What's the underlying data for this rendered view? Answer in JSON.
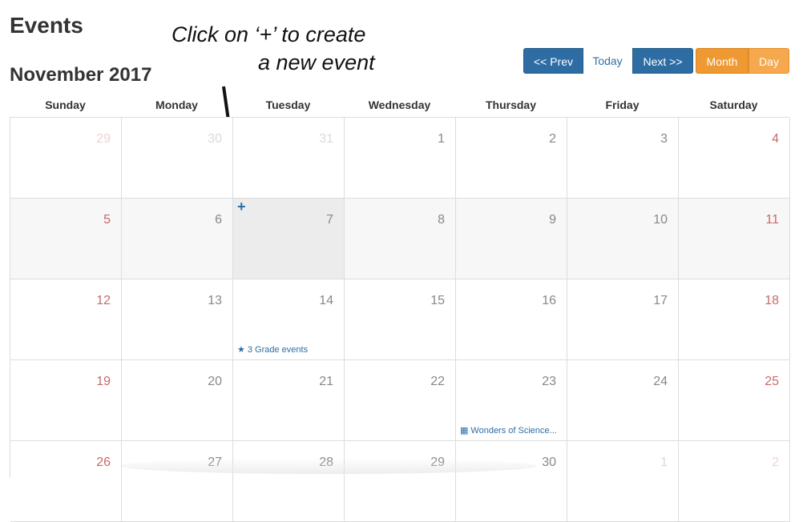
{
  "page": {
    "title": "Events"
  },
  "calendar": {
    "month_label": "November 2017",
    "weekdays": [
      "Sunday",
      "Monday",
      "Tuesday",
      "Wednesday",
      "Thursday",
      "Friday",
      "Saturday"
    ],
    "weeks": [
      [
        "29",
        "30",
        "31",
        "1",
        "2",
        "3",
        "4"
      ],
      [
        "5",
        "6",
        "7",
        "8",
        "9",
        "10",
        "11"
      ],
      [
        "12",
        "13",
        "14",
        "15",
        "16",
        "17",
        "18"
      ],
      [
        "19",
        "20",
        "21",
        "22",
        "23",
        "24",
        "25"
      ],
      [
        "26",
        "27",
        "28",
        "29",
        "30",
        "1",
        "2"
      ]
    ],
    "events": {
      "w2d2": {
        "icon": "star-icon",
        "glyph": "★",
        "label": "3 Grade events"
      },
      "w3d4": {
        "icon": "building-icon",
        "glyph": "▦",
        "label": "Wonders of Science..."
      }
    },
    "add_event_glyph": "+"
  },
  "toolbar": {
    "prev_label": "<< Prev",
    "today_label": "Today",
    "next_label": "Next >>",
    "month_label": "Month",
    "day_label": "Day"
  },
  "annotation": {
    "line1": "Click on ‘+’ to create",
    "line2": "a new event"
  },
  "colors": {
    "primary": "#2e6da4",
    "accent": "#ef9932",
    "weekend_text": "#c86a6a"
  }
}
